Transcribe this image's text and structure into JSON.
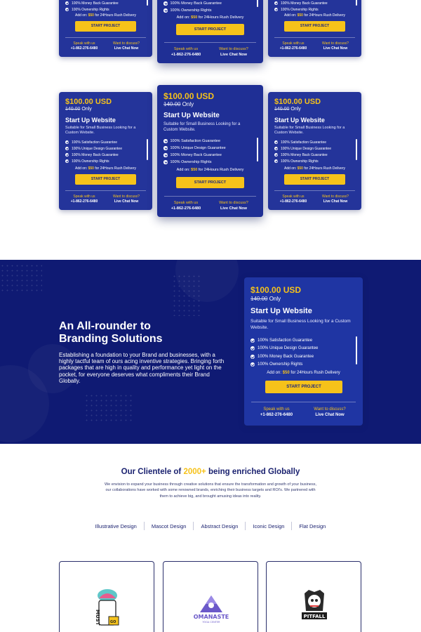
{
  "pricing": {
    "cards": [
      {
        "price": "$100.00 USD",
        "old_price": "140.00",
        "old_suffix": "Only",
        "title": "Start Up Website",
        "description": "Suitable for Small Business Looking for a Custom Website.",
        "features": [
          "100% Satisfaction Guarantee",
          "100% Unique Design Guarantee",
          "100% Money Back Guarantee",
          "100% Ownership Rights"
        ],
        "addon_prefix": "Add on:",
        "addon_price": "$50",
        "addon_suffix": "for 24Hours Rush Delivery",
        "cta": "START PROJECT",
        "speak_label": "Speak with us",
        "phone": "+1-862-276-6480",
        "discuss_label": "Want to discuss?",
        "chat": "Live Chat Now"
      }
    ]
  },
  "hero": {
    "heading_line1": "An All-rounder to",
    "heading_line2": "Branding Solutions",
    "body": "Establishing a foundation to your Brand and businesses, with a highly tactful team of ours acing inventive strategies. Bringing forth packages that are high in quality and performance yet light on the pocket, for everyone deserves what compliments their Brand Globally."
  },
  "clientele": {
    "title_prefix": "Our Clientele of",
    "title_highlight": "2000+",
    "title_suffix": "being enriched Globally",
    "description": "We envision to expand your business through creative solutions that ensure the transformation and growth of your business, our collaborations have worked with some renowned brands, enriching their business targets and ROI's. We partnered with them to achieve big, and brought amusing ideas into reality.",
    "categories": [
      "Illustrative Design",
      "Mascot Design",
      "Abstract Design",
      "Iconic Design",
      "Flat Design"
    ],
    "logos": [
      {
        "text": "MUST",
        "sub": "GO"
      },
      {
        "text": "OMANASTE",
        "sub": "YOGA CENTER"
      },
      {
        "text": "PITFALL"
      }
    ]
  },
  "colors": {
    "card_bg": "#24349a",
    "hero_bg": "#0f1a73",
    "accent": "#f6c21a",
    "heading": "#1b2270"
  }
}
